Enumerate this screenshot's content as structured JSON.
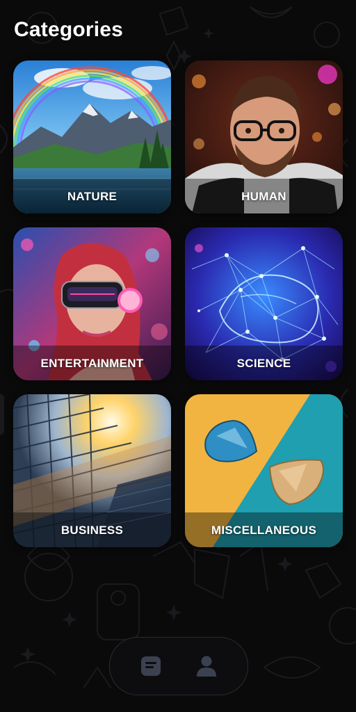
{
  "header": {
    "title": "Categories"
  },
  "categories": [
    {
      "label": "NATURE",
      "icon": "mountain-lake-image"
    },
    {
      "label": "HUMAN",
      "icon": "portrait-image"
    },
    {
      "label": "ENTERTAINMENT",
      "icon": "vr-headset-image"
    },
    {
      "label": "SCIENCE",
      "icon": "neural-network-image"
    },
    {
      "label": "BUSINESS",
      "icon": "glass-building-image"
    },
    {
      "label": "MISCELLANEOUS",
      "icon": "guitar-picks-image"
    }
  ],
  "bottom_nav": {
    "items": [
      {
        "icon": "document-icon",
        "active": true
      },
      {
        "icon": "profile-icon",
        "active": false
      }
    ]
  },
  "colors": {
    "background": "#0a0a0b",
    "text": "#ffffff",
    "nav_border": "#2c2c30",
    "nav_icon": "#3b4150"
  }
}
